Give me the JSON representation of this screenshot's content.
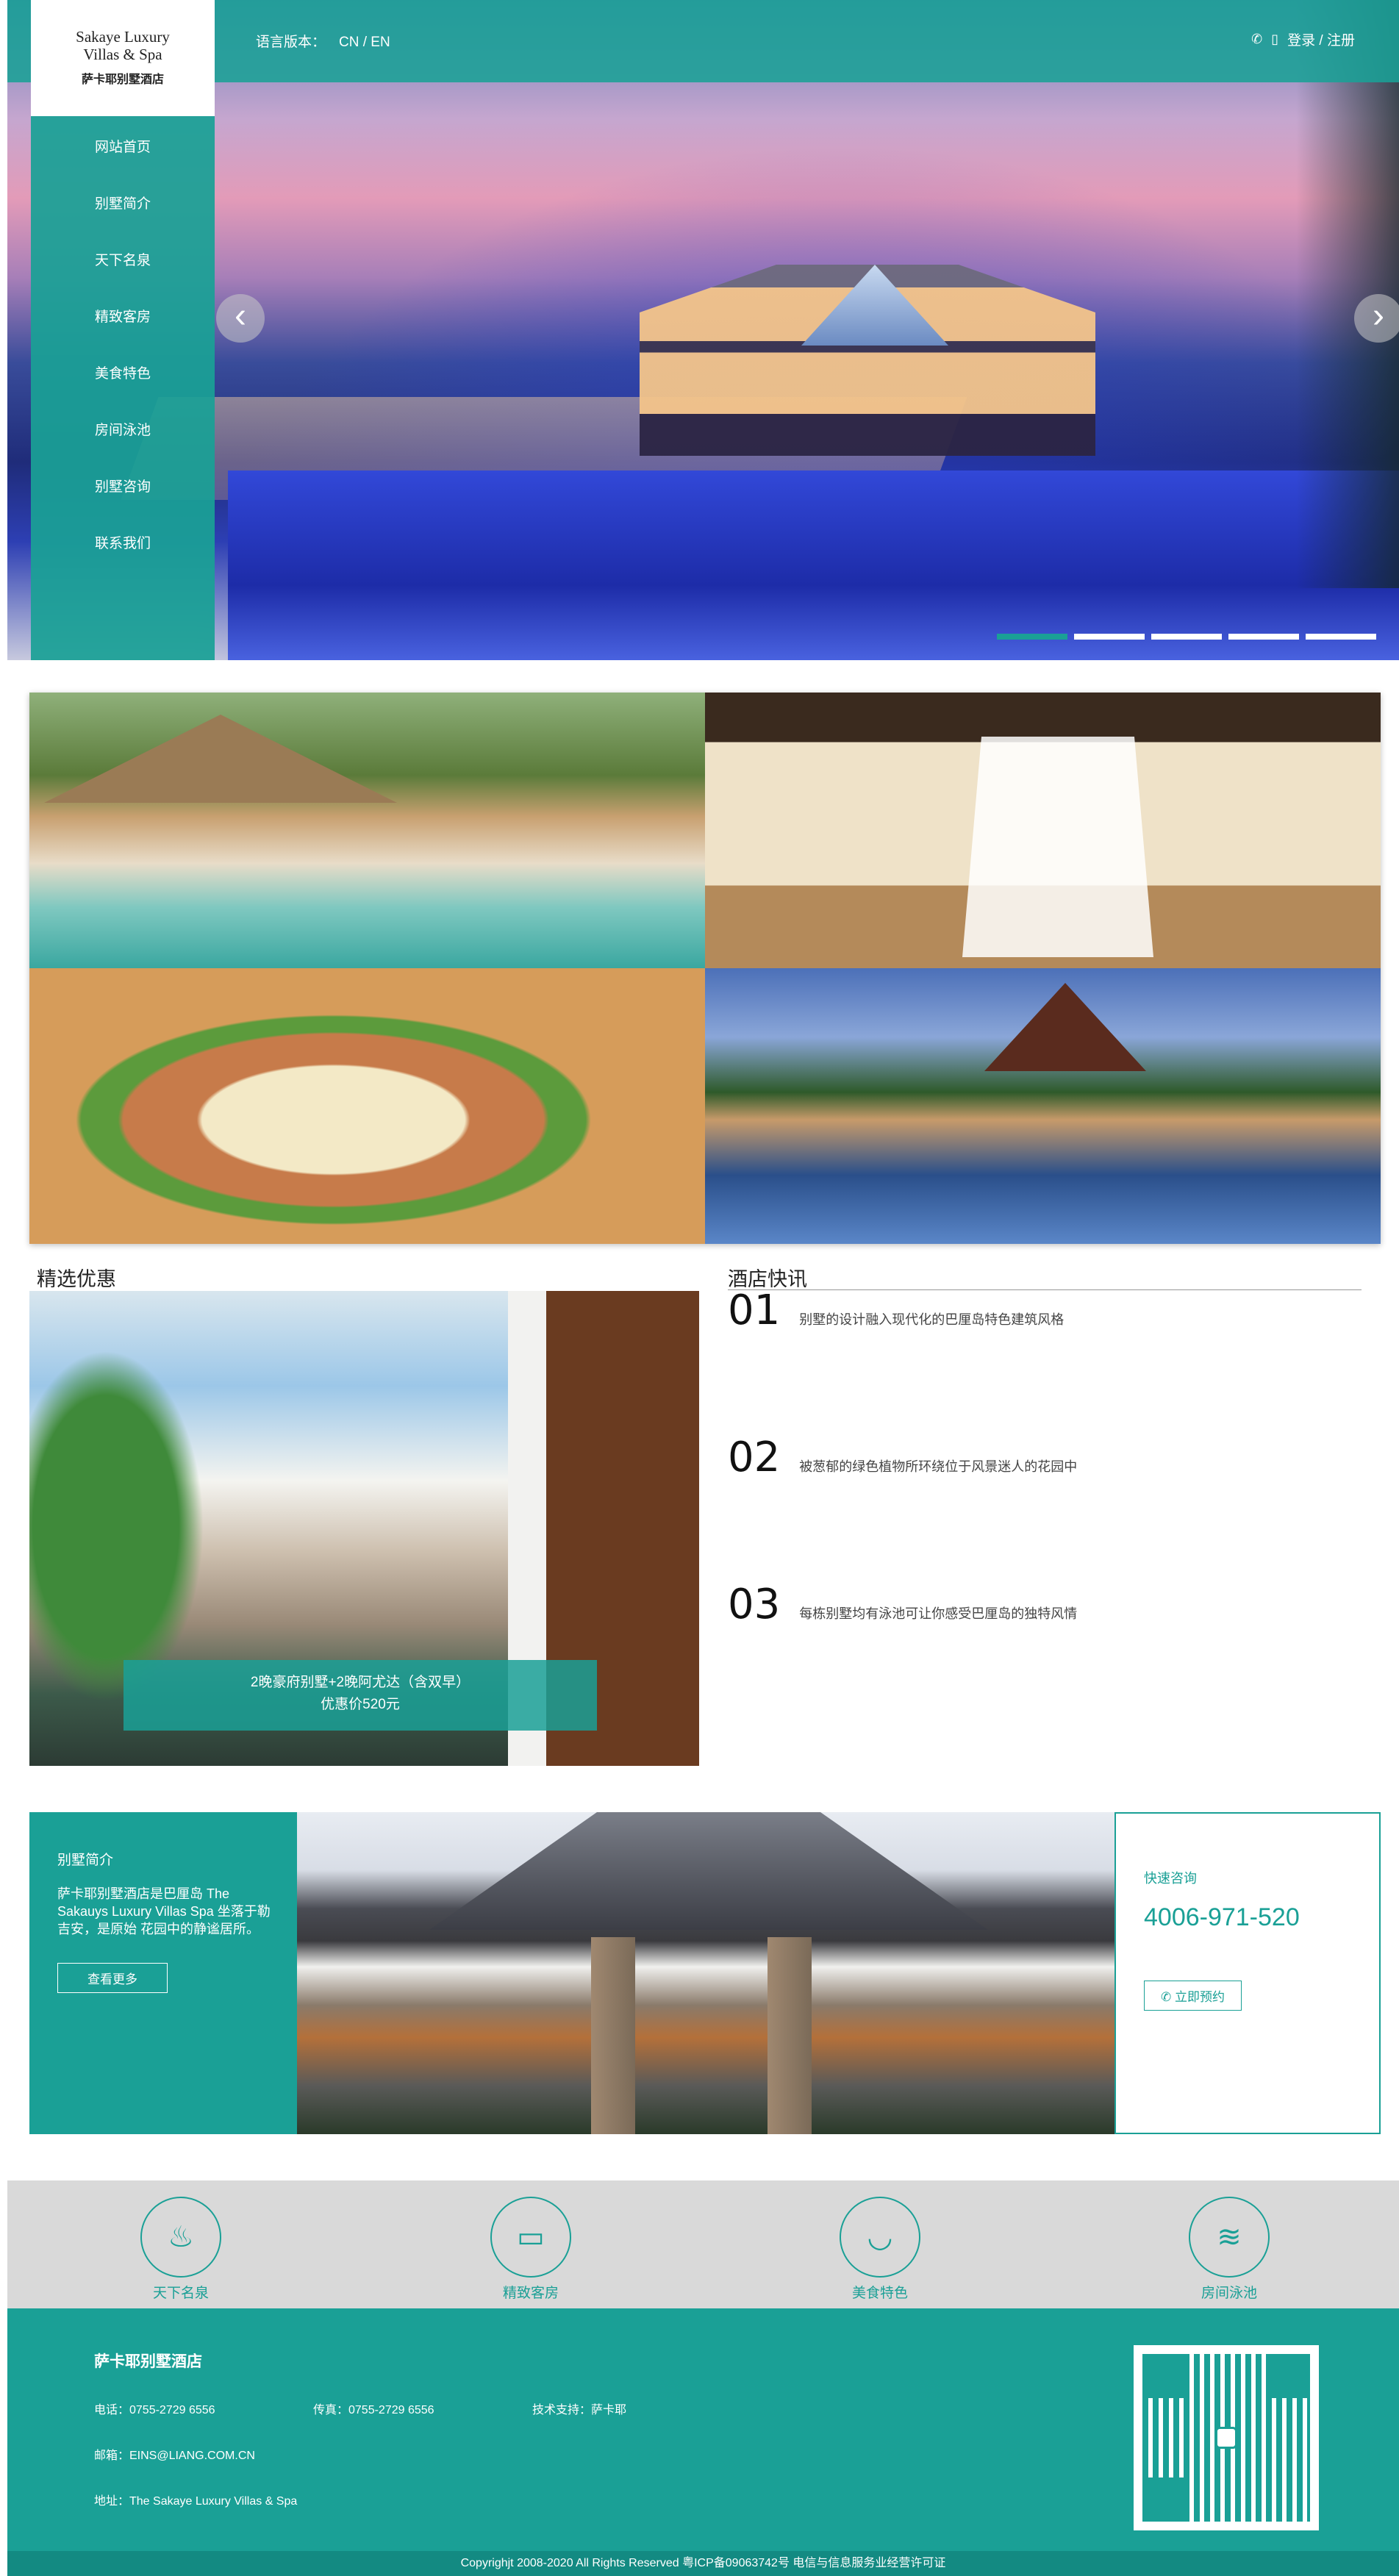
{
  "logo": {
    "en_line1": "Sakaye Luxury",
    "en_line2": "Villas & Spa",
    "cn": "萨卡耶别墅酒店"
  },
  "topbar": {
    "lang_label": "语言版本：",
    "lang_options": "CN / EN",
    "login": "登录 / 注册"
  },
  "nav": [
    "网站首页",
    "别墅简介",
    "天下名泉",
    "精致客房",
    "美食特色",
    "房间泳池",
    "别墅咨询",
    "联系我们"
  ],
  "slider": {
    "prev": "‹",
    "next": "›",
    "count": 5,
    "active": 1
  },
  "sections": {
    "offers_title": "精选优惠",
    "news_title": "酒店快讯"
  },
  "offer": {
    "line1": "2晚豪府别墅+2晚阿尤达（含双早）",
    "line2": "优惠价520元"
  },
  "news": [
    {
      "num": "01",
      "text": "别墅的设计融入现代化的巴厘岛特色建筑风格"
    },
    {
      "num": "02",
      "text": "被葱郁的绿色植物所环绕位于风景迷人的花园中"
    },
    {
      "num": "03",
      "text": "每栋别墅均有泳池可让你感受巴厘岛的独特风情"
    }
  ],
  "about": {
    "title": "别墅简介",
    "desc": "萨卡耶别墅酒店是巴厘岛 The Sakauys Luxury Villas Spa 坐落于勒吉安，是原始 花园中的静谧居所。",
    "more": "查看更多"
  },
  "contact": {
    "label": "快速咨询",
    "phone": "4006-971-520",
    "book": "立即预约"
  },
  "features": [
    {
      "label": "天下名泉",
      "icon": "hot-spring-icon",
      "glyph": "♨"
    },
    {
      "label": "精致客房",
      "icon": "bed-icon",
      "glyph": "▭"
    },
    {
      "label": "美食特色",
      "icon": "noodle-bowl-icon",
      "glyph": "◡"
    },
    {
      "label": "房间泳池",
      "icon": "swimming-icon",
      "glyph": "≋"
    }
  ],
  "footer": {
    "name": "萨卡耶别墅酒店",
    "tel": "电话：0755-2729 6556",
    "fax": "传真：0755-2729 6556",
    "support": "技术支持：萨卡耶",
    "email": "邮箱：EINS@LIANG.COM.CN",
    "address": "地址：The Sakaye Luxury Villas & Spa",
    "copyright": "Copyrighjt 2008-2020 All Rights Reserved 粤ICP备09063742号 电信与信息服务业经营许可证"
  },
  "colors": {
    "accent": "#1aa096",
    "feature_bg": "#d9d9d9",
    "copyright_bg": "#138a82"
  }
}
